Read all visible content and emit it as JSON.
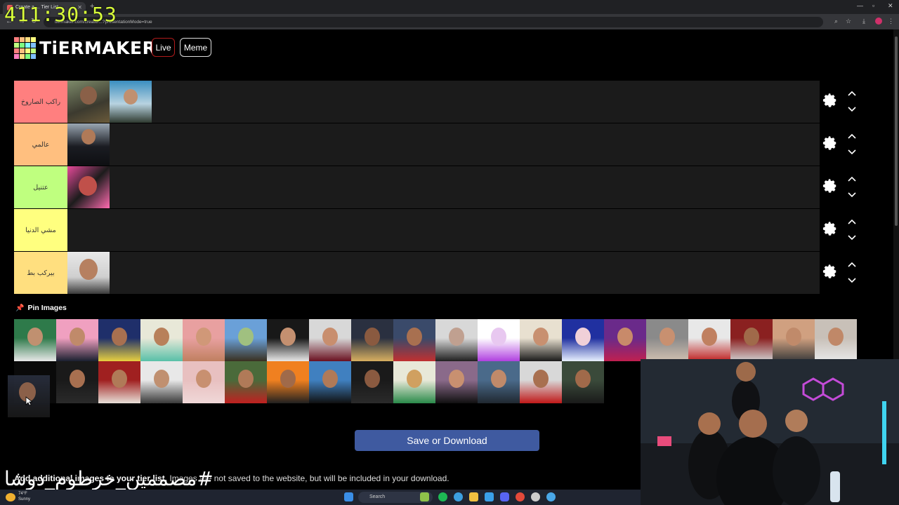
{
  "browser": {
    "tab_title": "Create a ... Tier List",
    "url": "tiermaker.com/create/...?presentationMode=true"
  },
  "stream": {
    "timer": "411:30:53",
    "caption": "#مصممين_خرطوم_دوشا"
  },
  "header": {
    "logo_text": "TiERMAKER",
    "live_label": "Live",
    "meme_label": "Meme",
    "logo_colors": [
      "#ff7f7f",
      "#ffbf7f",
      "#ffdf7f",
      "#ffff7f",
      "#bfff7f",
      "#7fff7f",
      "#7fffff",
      "#7fbfff",
      "#ff7f7f",
      "#ffbf7f",
      "#ffff7f",
      "#bfff7f",
      "#ff7fbf",
      "#ffdf7f",
      "#7fff7f",
      "#7fbfff"
    ]
  },
  "tiers": [
    {
      "label": "راكب الصاروخ",
      "color": "#ff7f7f",
      "item_count": 2
    },
    {
      "label": "عالمي",
      "color": "#ffbf7f",
      "item_count": 1
    },
    {
      "label": "عتنيل",
      "color": "#bfff7f",
      "item_count": 1
    },
    {
      "label": "مشي الدنيا",
      "color": "#ffff7f",
      "item_count": 0
    },
    {
      "label": "بيركب بط",
      "color": "#ffdf7f",
      "item_count": 1
    }
  ],
  "pin_images_label": "Pin Images",
  "pool": {
    "row1_count": 20,
    "row2_count": 13
  },
  "save_button": "Save or Download",
  "footer_note_bold": "Add additional images to your tier list.",
  "footer_note_rest": " Images are not saved to the website, but will be included in your download.",
  "taskbar": {
    "weather_temp": "74°F",
    "weather_desc": "Sunny",
    "search_placeholder": "Search"
  }
}
